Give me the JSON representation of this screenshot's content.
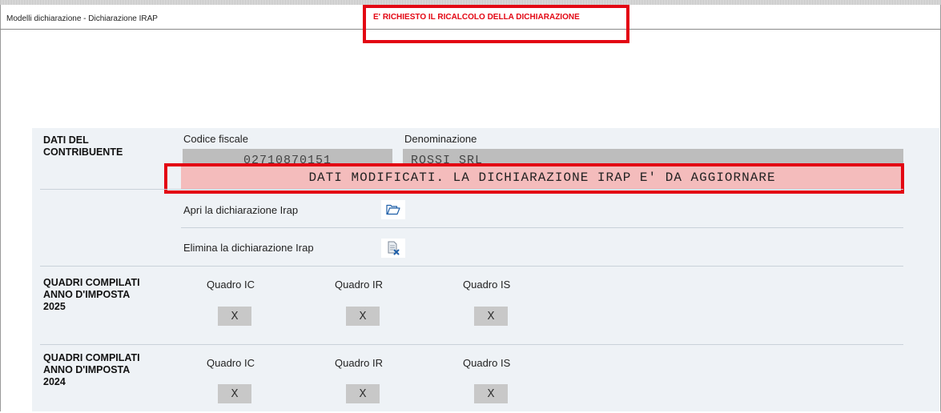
{
  "window": {
    "title": "Modelli dichiarazione - Dichiarazione IRAP",
    "alert": "E' RICHIESTO IL RICALCOLO DELLA DICHIARAZIONE"
  },
  "contribuente": {
    "section_label_1": "DATI DEL",
    "section_label_2": "CONTRIBUENTE",
    "codice_fiscale_label": "Codice fiscale",
    "codice_fiscale_value": "02710870151",
    "denominazione_label": "Denominazione",
    "denominazione_value": "ROSSI SRL",
    "warning": "DATI MODIFICATI. LA DICHIARAZIONE IRAP E' DA AGGIORNARE"
  },
  "actions": {
    "open_label": "Apri la dichiarazione Irap",
    "open_icon": "folder-open-icon",
    "delete_label": "Elimina la dichiarazione Irap",
    "delete_icon": "delete-document-icon"
  },
  "quadri": [
    {
      "label_1": "QUADRI COMPILATI",
      "label_2": "ANNO D'IMPOSTA",
      "label_3": "2025",
      "items": [
        {
          "name": "Quadro IC",
          "value": "X"
        },
        {
          "name": "Quadro IR",
          "value": "X"
        },
        {
          "name": "Quadro IS",
          "value": "X"
        }
      ]
    },
    {
      "label_1": "QUADRI COMPILATI",
      "label_2": "ANNO D'IMPOSTA",
      "label_3": "2024",
      "items": [
        {
          "name": "Quadro IC",
          "value": "X"
        },
        {
          "name": "Quadro IR",
          "value": "X"
        },
        {
          "name": "Quadro IS",
          "value": "X"
        }
      ]
    }
  ],
  "colors": {
    "alert_red": "#e30613",
    "warning_bg": "#f4bcbc",
    "panel_bg": "#eef2f6",
    "field_bg": "#bdbdbd"
  }
}
